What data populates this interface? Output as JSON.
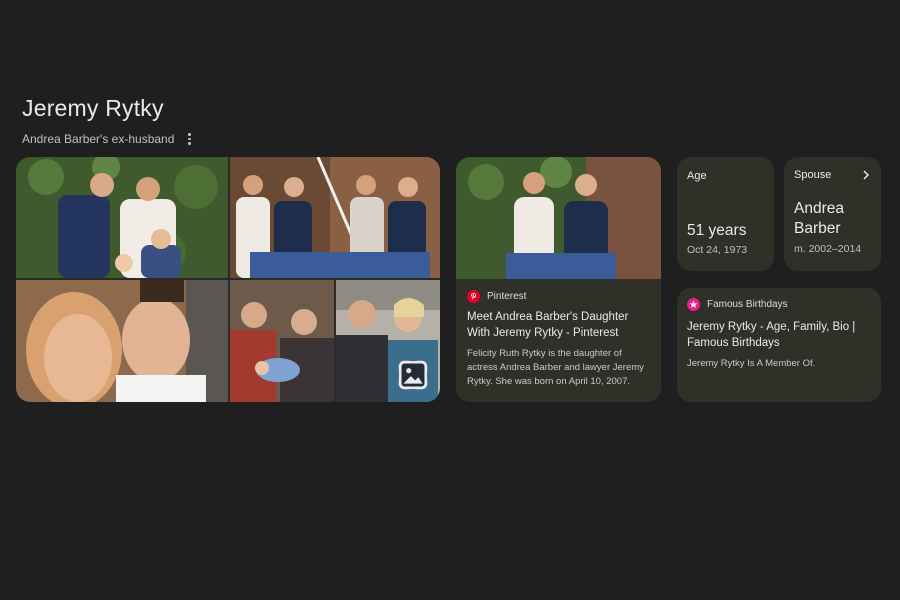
{
  "entity": {
    "name": "Jeremy Rytky",
    "description": "Andrea Barber's ex-husband"
  },
  "icons": {
    "more": "more-vert-icon",
    "image": "image-icon",
    "chevron": "chevron-right-icon",
    "pinterest": "pinterest-logo-icon",
    "famous_birthdays": "famous-birthdays-logo-icon"
  },
  "photo_collage": {
    "count": 5
  },
  "pinterest_card": {
    "source": "Pinterest",
    "title": "Meet Andrea Barber's Daughter With Jeremy Rytky - Pinterest",
    "snippet": "Felicity Ruth Rytky is the daughter of actress Andrea Barber and lawyer Jeremy Rytky. She was born on April 10, 2007."
  },
  "age_card": {
    "label": "Age",
    "value": "51 years",
    "detail": "Oct 24, 1973"
  },
  "spouse_card": {
    "label": "Spouse",
    "value": "Andrea Barber",
    "detail": "m. 2002–2014"
  },
  "famous_card": {
    "source": "Famous Birthdays",
    "title": "Jeremy Rytky - Age, Family, Bio | Famous Birthdays",
    "snippet": "Jeremy Rytky Is A Member Of."
  },
  "colors": {
    "background": "#1f1f1f",
    "card": "#2f3129",
    "text": "#e8eaed",
    "pinterest": "#e60023",
    "famous_birthdays": "#e91e8c"
  }
}
